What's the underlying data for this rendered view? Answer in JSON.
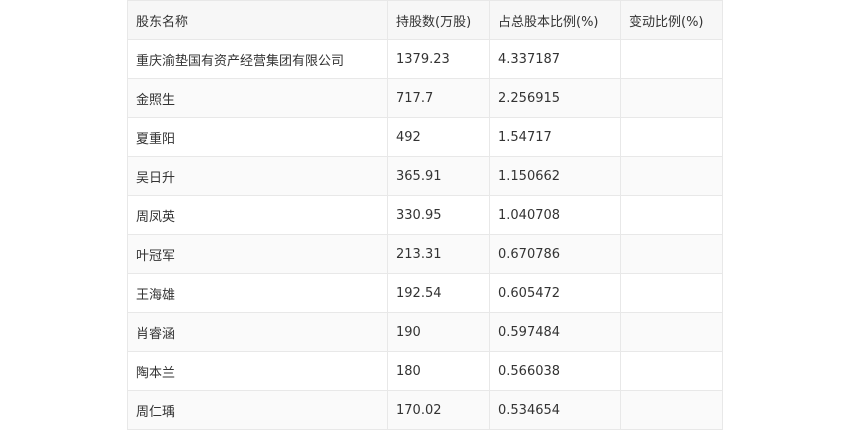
{
  "table": {
    "headers": [
      "股东名称",
      "持股数(万股)",
      "占总股本比例(%)",
      "变动比例(%)"
    ],
    "rows": [
      [
        "重庆渝垫国有资产经营集团有限公司",
        "1379.23",
        "4.337187",
        ""
      ],
      [
        "金照生",
        "717.7",
        "2.256915",
        ""
      ],
      [
        "夏重阳",
        "492",
        "1.54717",
        ""
      ],
      [
        "吴日升",
        "365.91",
        "1.150662",
        ""
      ],
      [
        "周凤英",
        "330.95",
        "1.040708",
        ""
      ],
      [
        "叶冠军",
        "213.31",
        "0.670786",
        ""
      ],
      [
        "王海雄",
        "192.54",
        "0.605472",
        ""
      ],
      [
        "肖睿涵",
        "190",
        "0.597484",
        ""
      ],
      [
        "陶本兰",
        "180",
        "0.566038",
        ""
      ],
      [
        "周仁瑀",
        "170.02",
        "0.534654",
        ""
      ]
    ]
  }
}
